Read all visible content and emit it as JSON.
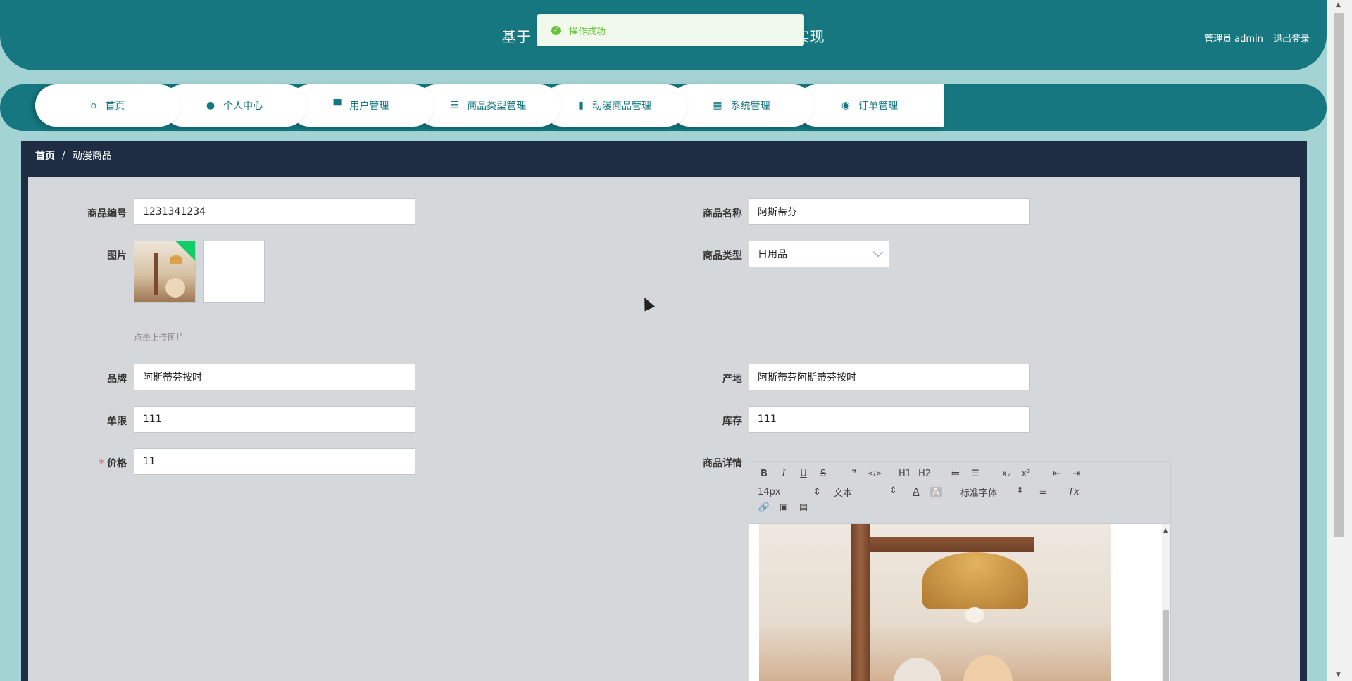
{
  "header": {
    "title_left": "基于",
    "title_right": "实现",
    "user": "管理员 admin",
    "logout": "退出登录"
  },
  "toast": {
    "message": "操作成功"
  },
  "nav": [
    {
      "label": "首页",
      "icon": "home-icon",
      "glyph": "⌂"
    },
    {
      "label": "个人中心",
      "icon": "user-icon",
      "glyph": "●"
    },
    {
      "label": "用户管理",
      "icon": "monitor-icon",
      "glyph": "▀"
    },
    {
      "label": "商品类型管理",
      "icon": "sliders-icon",
      "glyph": "☰"
    },
    {
      "label": "动漫商品管理",
      "icon": "clipboard-icon",
      "glyph": "▮"
    },
    {
      "label": "系统管理",
      "icon": "grid-icon",
      "glyph": "▦"
    },
    {
      "label": "订单管理",
      "icon": "bulb-icon",
      "glyph": "◉"
    }
  ],
  "breadcrumb": {
    "home": "首页",
    "sep": "/",
    "current": "动漫商品"
  },
  "form": {
    "code": {
      "label": "商品编号",
      "value": "1231341234"
    },
    "name": {
      "label": "商品名称",
      "value": "阿斯蒂芬"
    },
    "image": {
      "label": "图片",
      "tip": "点击上传图片"
    },
    "type": {
      "label": "商品类型",
      "value": "日用品"
    },
    "brand": {
      "label": "品牌",
      "value": "阿斯蒂芬按时"
    },
    "origin": {
      "label": "产地",
      "value": "阿斯蒂芬阿斯蒂芬按时"
    },
    "limit": {
      "label": "单限",
      "value": "111"
    },
    "stock": {
      "label": "库存",
      "value": "111"
    },
    "price": {
      "label": "价格",
      "required": "*",
      "value": "11"
    },
    "detail": {
      "label": "商品详情"
    }
  },
  "editor": {
    "row1": [
      "B",
      "I",
      "U",
      "S",
      "❞",
      "</>",
      "H1",
      "H2",
      "≔",
      "☰",
      "x₂",
      "x²",
      "⇤",
      "⇥"
    ],
    "size": "14px",
    "text_style": "文本",
    "font": "标准字体",
    "row3": [
      "🔗",
      "▣",
      "▤"
    ],
    "color_a": "A",
    "align": "≡",
    "clear": "Tx"
  },
  "colors": {
    "primary": "#167780",
    "page_bg": "#a4d3d4",
    "dark_bar": "#1f2d44",
    "success": "#67c23a"
  }
}
